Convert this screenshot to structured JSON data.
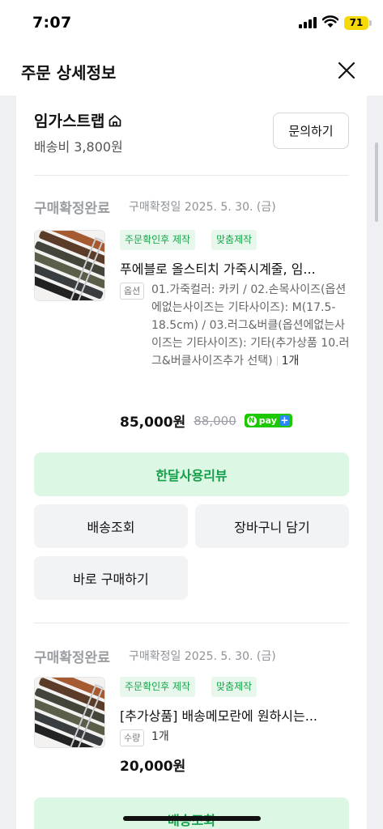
{
  "status_bar": {
    "time": "7:07",
    "battery": "71"
  },
  "header": {
    "title": "주문 상세정보"
  },
  "seller": {
    "name": "임가스트랩",
    "shipping_fee": "배송비 3,800원",
    "inquiry_label": "문의하기"
  },
  "orders": [
    {
      "status": "구매확정완료",
      "confirm_date": "구매확정일 2025. 5. 30. (금)",
      "badges": [
        "주문확인후 제작",
        "맞춤제작"
      ],
      "product_name": "푸에블로 올스티치 가죽시계줄, 임...",
      "option_tag": "옵션",
      "option_text": "01.가죽컬러: 카키 / 02.손목사이즈(옵션에없는사이즈는 기타사이즈): M(17.5-18.5cm) / 03.러그&버클(옵션에없는사이즈는 기타사이즈): 기타(추가상품 10.러그&버클사이즈추가 선택)",
      "quantity": "1개",
      "price": "85,000원",
      "original_price": "88,000",
      "npay_label": "pay",
      "actions": {
        "review": "한달사용리뷰",
        "track": "배송조회",
        "cart": "장바구니 담기",
        "buy_again": "바로 구매하기"
      }
    },
    {
      "status": "구매확정완료",
      "confirm_date": "구매확정일 2025. 5. 30. (금)",
      "badges": [
        "주문확인후 제작",
        "맞춤제작"
      ],
      "product_name": "[추가상품] 배송메모란에 원하시는...",
      "option_tag": "수량",
      "quantity": "1개",
      "price": "20,000원",
      "actions": {
        "track": "배송조회"
      }
    }
  ],
  "colors": {
    "accent_green": "#13a049",
    "green_bg": "#dcf7e3",
    "npay_green": "#1ec800",
    "status_grey": "#9a9da2"
  }
}
